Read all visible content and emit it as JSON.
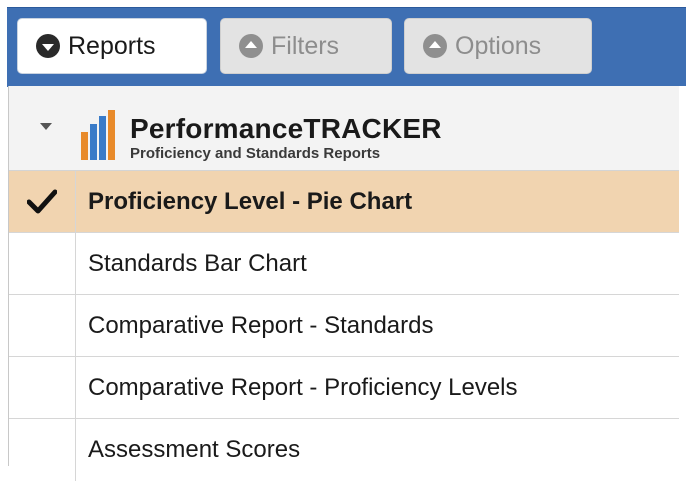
{
  "toolbar": {
    "tabs": [
      {
        "label": "Reports",
        "state": "active"
      },
      {
        "label": "Filters",
        "state": "inactive"
      },
      {
        "label": "Options",
        "state": "inactive"
      }
    ]
  },
  "group": {
    "title": "PerformanceTRACKER",
    "subtitle": "Proficiency and Standards Reports"
  },
  "reports": [
    {
      "label": "Proficiency Level - Pie Chart",
      "selected": true
    },
    {
      "label": "Standards Bar Chart",
      "selected": false
    },
    {
      "label": "Comparative Report - Standards",
      "selected": false
    },
    {
      "label": "Comparative Report - Proficiency Levels",
      "selected": false
    },
    {
      "label": "Assessment Scores",
      "selected": false
    }
  ],
  "colors": {
    "header_blue": "#3e6fb3",
    "selected_row": "#f1d4b0",
    "logo_blue": "#3a7bc8",
    "logo_orange": "#e88a2a"
  },
  "icons": {
    "reports_tab": "chevron-down-circle-icon",
    "filters_tab": "chevron-up-circle-icon",
    "options_tab": "chevron-up-circle-icon",
    "selected_mark": "checkmark-icon",
    "group_toggle": "caret-down-icon",
    "logo": "bar-chart-logo-icon"
  }
}
